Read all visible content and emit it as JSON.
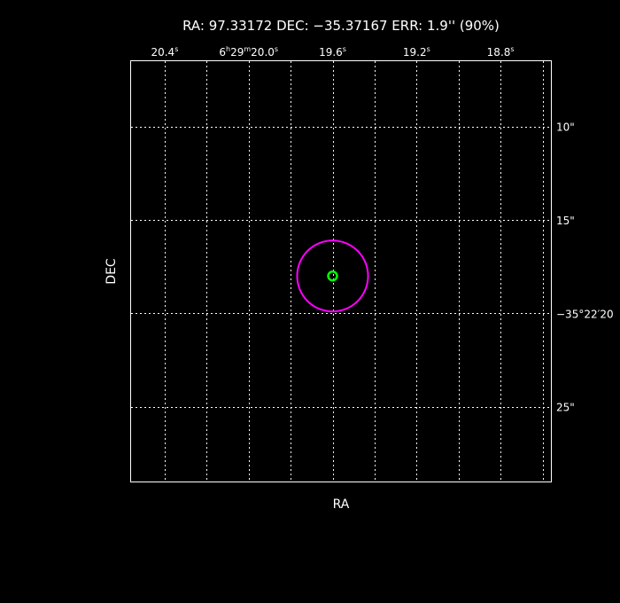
{
  "chart_data": {
    "type": "scatter",
    "title": "RA: 97.33172   DEC: −35.37167   ERR: 1.9'' (90%)",
    "xlabel": "RA",
    "ylabel": "DEC",
    "grid": true,
    "xlim_sec": [
      20.56,
      18.56
    ],
    "ylim_arcsec": [
      6.5,
      29.0
    ],
    "x_ticks": [
      {
        "value": 20.4,
        "base": "20.4",
        "sup": "s"
      },
      {
        "value": 20.0,
        "prefix": "6",
        "prefix_sup": "h",
        "mid": "29",
        "mid_sup": "m",
        "base": "20.0",
        "sup": "s"
      },
      {
        "value": 19.6,
        "base": "19.6",
        "sup": "s"
      },
      {
        "value": 19.2,
        "base": "19.2",
        "sup": "s"
      },
      {
        "value": 18.8,
        "base": "18.8",
        "sup": "s"
      }
    ],
    "x_minor_grid": [
      20.2,
      19.8,
      19.4,
      19.0,
      18.6
    ],
    "y_ticks": [
      {
        "value": 10,
        "label": "10\""
      },
      {
        "value": 15,
        "label": "15\""
      },
      {
        "value": 20,
        "label": "−35°22′20"
      },
      {
        "value": 25,
        "label": "25\""
      }
    ],
    "source": {
      "ra_sec": 19.6,
      "dec_arcsec": 18.0
    },
    "error_radius_arcsec": 1.9,
    "colors": {
      "error_circle": "#ff00ff",
      "source_marker": "#00ff00",
      "grid": "#ffffff",
      "background": "#000000",
      "text": "#ffffff"
    }
  }
}
